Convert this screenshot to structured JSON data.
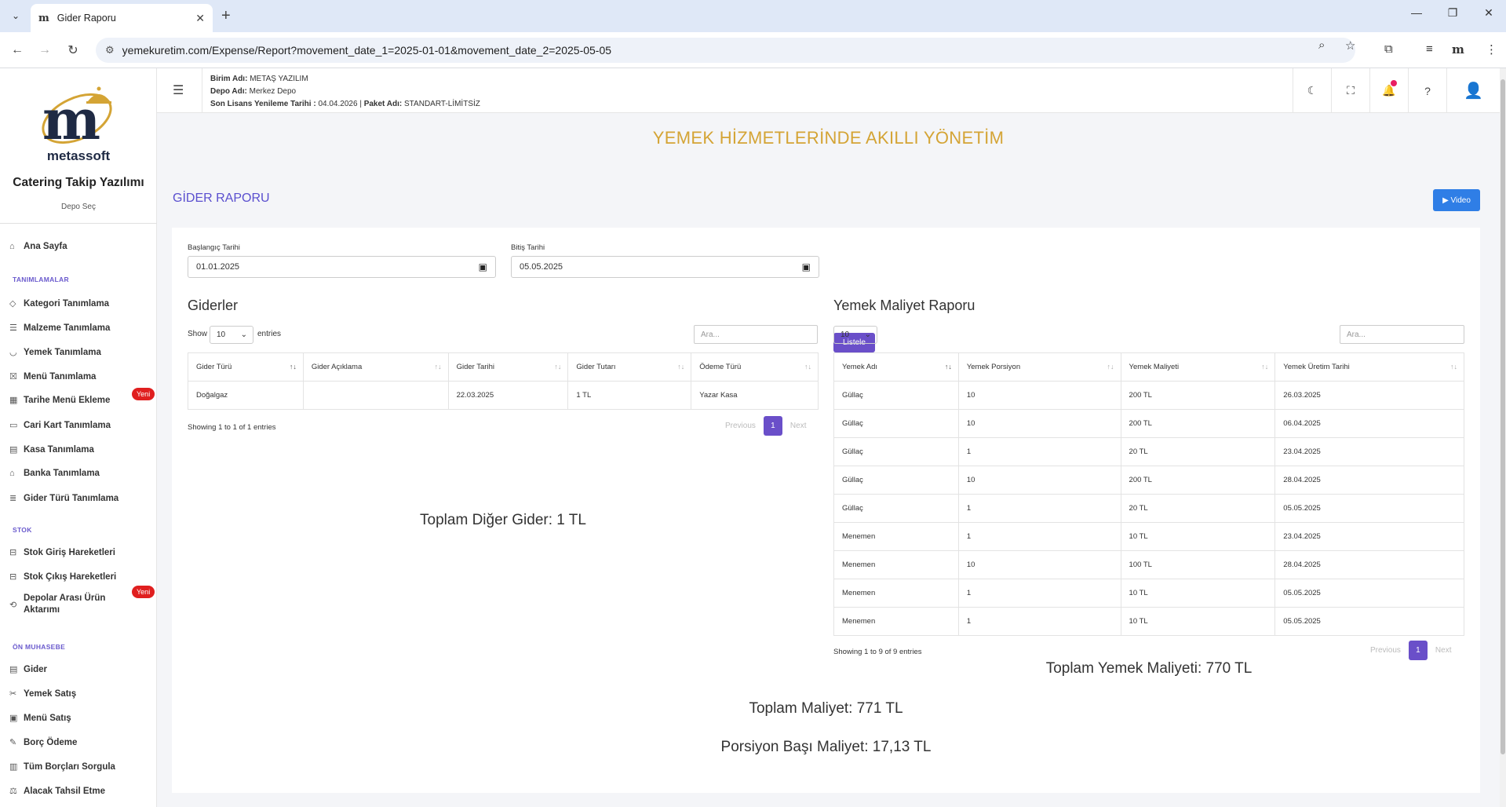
{
  "browser": {
    "tab_title": "Gider Raporu",
    "favicon_text": "m",
    "url": "yemekuretim.com/Expense/Report?movement_date_1=2025-01-01&movement_date_2=2025-05-05"
  },
  "sidebar": {
    "brand_logo_text": "metassoft",
    "brand": "Catering Takip Yazılımı",
    "depo_sec": "Depo Seç",
    "items": [
      {
        "label": "Ana Sayfa",
        "icon": "home-icon"
      },
      {
        "section": "TANIMLAMALAR"
      },
      {
        "label": "Kategori Tanımlama",
        "icon": "tag-icon"
      },
      {
        "label": "Malzeme Tanımlama",
        "icon": "layers-icon"
      },
      {
        "label": "Yemek Tanımlama",
        "icon": "bowl-icon"
      },
      {
        "label": "Menü Tanımlama",
        "icon": "menu-board-icon"
      },
      {
        "label": "Tarihe Menü Ekleme",
        "icon": "calendar-icon",
        "badge": "Yeni"
      },
      {
        "label": "Cari Kart Tanımlama",
        "icon": "card-icon"
      },
      {
        "label": "Kasa Tanımlama",
        "icon": "register-icon"
      },
      {
        "label": "Banka Tanımlama",
        "icon": "bank-icon"
      },
      {
        "label": "Gider Türü Tanımlama",
        "icon": "list-icon"
      },
      {
        "section": "STOK"
      },
      {
        "label": "Stok Giriş Hareketleri",
        "icon": "stock-in-icon"
      },
      {
        "label": "Stok Çıkış Hareketleri",
        "icon": "stock-out-icon"
      },
      {
        "label": "Depolar Arası Ürün Aktarımı",
        "icon": "transfer-icon",
        "badge": "Yeni"
      },
      {
        "section": "ÖN MUHASEBE"
      },
      {
        "label": "Gider",
        "icon": "expense-icon"
      },
      {
        "label": "Yemek Satış",
        "icon": "sale-icon"
      },
      {
        "label": "Menü Satış",
        "icon": "menu-sale-icon"
      },
      {
        "label": "Borç Ödeme",
        "icon": "pencil-icon"
      },
      {
        "label": "Tüm Borçları Sorgula",
        "icon": "debt-icon"
      },
      {
        "label": "Alacak Tahsil Etme",
        "icon": "collect-icon"
      }
    ]
  },
  "header": {
    "birim_label": "Birim Adı:",
    "birim_value": "METAŞ YAZILIM",
    "depo_label": "Depo Adı:",
    "depo_value": "Merkez Depo",
    "lisans_label": "Son Lisans Yenileme Tarihi :",
    "lisans_value": "04.04.2026",
    "paket_label": "Paket Adı:",
    "paket_value": "STANDART-LİMİTSİZ",
    "sep": "|"
  },
  "main": {
    "banner": "YEMEK HİZMETLERİNDE AKILLI YÖNETİM",
    "title": "GİDER RAPORU",
    "video_label": "Video",
    "start_label": "Başlangıç Tarihi",
    "start_value": "01.01.2025",
    "end_label": "Bitiş Tarihi",
    "end_value": "05.05.2025",
    "list_button": "Listele"
  },
  "expenses": {
    "title": "Giderler",
    "show": "Show",
    "page_size": "10",
    "entries": "entries",
    "search_placeholder": "Ara...",
    "columns": [
      "Gider Türü",
      "Gider Açıklama",
      "Gider Tarihi",
      "Gider Tutarı",
      "Ödeme Türü"
    ],
    "rows": [
      [
        "Doğalgaz",
        "",
        "22.03.2025",
        "1 TL",
        "Yazar Kasa"
      ]
    ],
    "info": "Showing 1 to 1 of 1 entries",
    "prev": "Previous",
    "page": "1",
    "next": "Next",
    "total": "Toplam Diğer Gider: 1 TL"
  },
  "food": {
    "title": "Yemek Maliyet Raporu",
    "page_size": "10",
    "search_placeholder": "Ara...",
    "columns": [
      "Yemek Adı",
      "Yemek Porsiyon",
      "Yemek Maliyeti",
      "Yemek Üretim Tarihi"
    ],
    "rows": [
      [
        "Güllaç",
        "10",
        "200 TL",
        "26.03.2025"
      ],
      [
        "Güllaç",
        "10",
        "200 TL",
        "06.04.2025"
      ],
      [
        "Güllaç",
        "1",
        "20 TL",
        "23.04.2025"
      ],
      [
        "Güllaç",
        "10",
        "200 TL",
        "28.04.2025"
      ],
      [
        "Güllaç",
        "1",
        "20 TL",
        "05.05.2025"
      ],
      [
        "Menemen",
        "1",
        "10 TL",
        "23.04.2025"
      ],
      [
        "Menemen",
        "10",
        "100 TL",
        "28.04.2025"
      ],
      [
        "Menemen",
        "1",
        "10 TL",
        "05.05.2025"
      ],
      [
        "Menemen",
        "1",
        "10 TL",
        "05.05.2025"
      ]
    ],
    "info": "Showing 1 to 9 of 9 entries",
    "prev": "Previous",
    "page": "1",
    "next": "Next",
    "total": "Toplam Yemek Maliyeti: 770 TL"
  },
  "totals": {
    "total_cost": "Toplam Maliyet: 771 TL",
    "per_portion": "Porsiyon Başı Maliyet: 17,13 TL"
  },
  "colors": {
    "accent": "#6a4fc9",
    "banner": "#d4a435",
    "video": "#2f7ee6",
    "badge": "#e01f1f"
  }
}
